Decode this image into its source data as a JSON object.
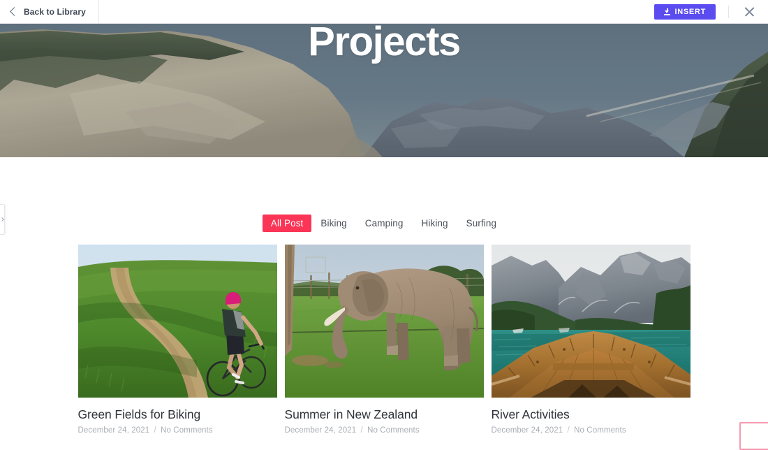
{
  "topbar": {
    "back_label": "Back to Library",
    "back_icon": "chevron-left-icon",
    "insert_label": "INSERT",
    "insert_icon": "download-icon",
    "close_icon": "close-icon",
    "insert_color": "#5b4cf0"
  },
  "left_handle": {
    "icon": "chevron-right-icon"
  },
  "hero": {
    "title": "Projects",
    "image_alt": "mountain-landscape-hero"
  },
  "filters": {
    "items": [
      {
        "label": "All Post",
        "active": true
      },
      {
        "label": "Biking",
        "active": false
      },
      {
        "label": "Camping",
        "active": false
      },
      {
        "label": "Hiking",
        "active": false
      },
      {
        "label": "Surfing",
        "active": false
      }
    ],
    "active_color": "#fa3556"
  },
  "posts": [
    {
      "title": "Green Fields for Biking",
      "date": "December 24, 2021",
      "separator": "/",
      "comments": "No Comments",
      "image_alt": "cyclist-on-green-hill"
    },
    {
      "title": "Summer in New Zealand",
      "date": "December 24, 2021",
      "separator": "/",
      "comments": "No Comments",
      "image_alt": "elephant-in-field"
    },
    {
      "title": "River Activities",
      "date": "December 24, 2021",
      "separator": "/",
      "comments": "No Comments",
      "image_alt": "wooden-boat-on-alpine-lake"
    }
  ],
  "corner_box": {
    "border_color": "#f59ab0"
  }
}
